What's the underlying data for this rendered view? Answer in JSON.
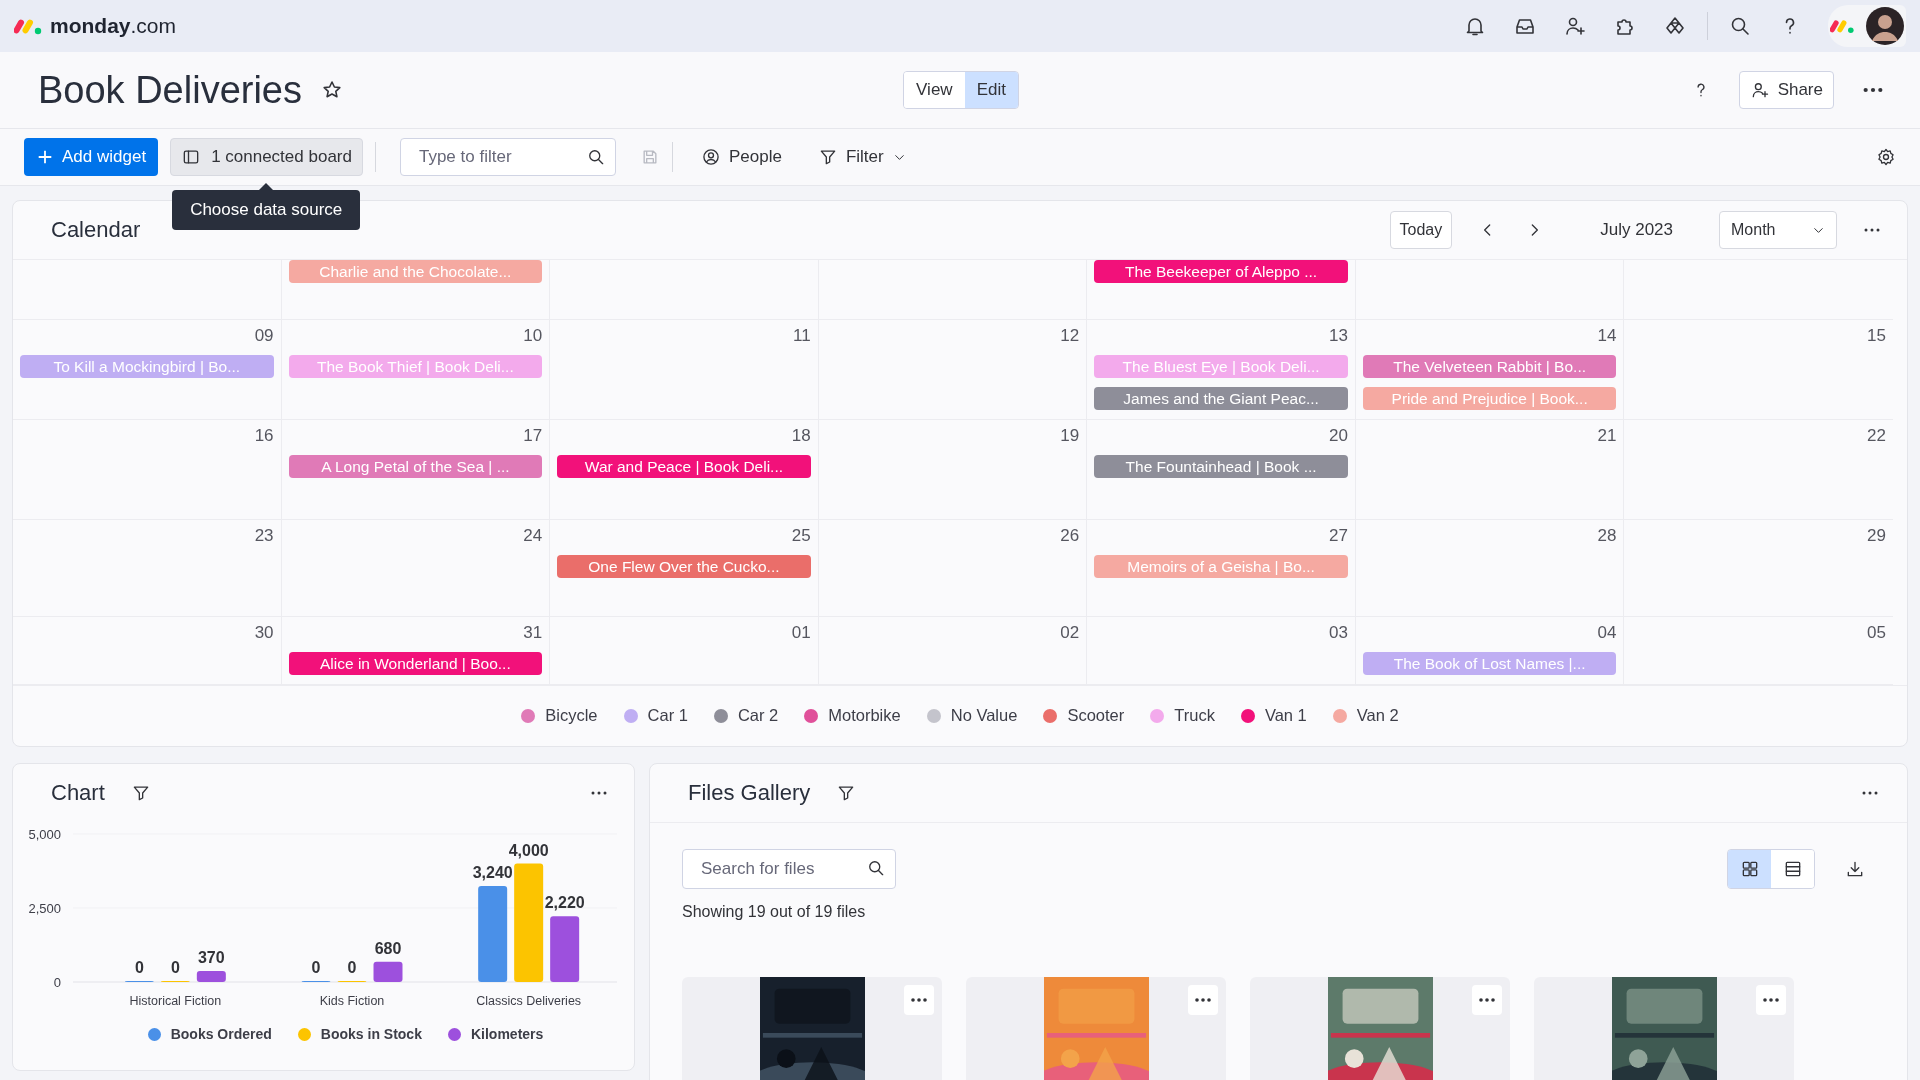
{
  "topbar": {
    "logo_word": "monday",
    "logo_suffix": ".com"
  },
  "header": {
    "title": "Book Deliveries",
    "modes": [
      {
        "label": "View",
        "selected": false
      },
      {
        "label": "Edit",
        "selected": true
      }
    ],
    "share": "Share"
  },
  "toolbar": {
    "add_widget": "Add widget",
    "connected_board": "1 connected board",
    "tooltip": "Choose data source",
    "filter_field": {
      "placeholder": "Type to filter"
    },
    "people": "People",
    "filter": "Filter"
  },
  "calendar": {
    "title": "Calendar",
    "today": "Today",
    "month_label": "July 2023",
    "view": "Month",
    "weeks": [
      [
        {
          "kind": "scrolled"
        },
        {
          "kind": "scrolled",
          "events": [
            {
              "title": "Charlie and the Chocolate...",
              "color": "#f5a9a1"
            }
          ]
        },
        {
          "kind": "scrolled"
        },
        {
          "kind": "scrolled"
        },
        {
          "kind": "scrolled",
          "events": [
            {
              "title": "The Beekeeper of Aleppo ...",
              "color": "#f2117a"
            }
          ]
        },
        {
          "kind": "scrolled"
        },
        {
          "kind": "scrolled"
        }
      ],
      [
        {
          "kind": "date",
          "day": "09",
          "events": [
            {
              "title": "To Kill a Mockingbird | Bo...",
              "color": "#bfaef3"
            }
          ]
        },
        {
          "kind": "date",
          "day": "10",
          "events": [
            {
              "title": "The Book Thief | Book Deli...",
              "color": "#f3aaec"
            }
          ]
        },
        {
          "kind": "date",
          "day": "11"
        },
        {
          "kind": "date",
          "day": "12"
        },
        {
          "kind": "date",
          "day": "13",
          "events": [
            {
              "title": "The Bluest Eye | Book Deli...",
              "color": "#f3aaec"
            },
            {
              "title": "James and the Giant Peac...",
              "color": "#8e8e99"
            }
          ]
        },
        {
          "kind": "date",
          "day": "14",
          "events": [
            {
              "title": "The Velveteen Rabbit | Bo...",
              "color": "#e07ab7"
            },
            {
              "title": "Pride and Prejudice | Book...",
              "color": "#f5a9a1"
            }
          ]
        },
        {
          "kind": "date",
          "day": "15"
        }
      ],
      [
        {
          "kind": "date",
          "day": "16"
        },
        {
          "kind": "date",
          "day": "17",
          "events": [
            {
              "title": "A Long Petal of the Sea | ...",
              "color": "#e07ab7"
            }
          ]
        },
        {
          "kind": "date",
          "day": "18",
          "events": [
            {
              "title": "War and Peace | Book Deli...",
              "color": "#f2117a"
            }
          ]
        },
        {
          "kind": "date",
          "day": "19"
        },
        {
          "kind": "date",
          "day": "20",
          "events": [
            {
              "title": "The Fountainhead | Book ...",
              "color": "#8e8e99"
            }
          ]
        },
        {
          "kind": "date",
          "day": "21"
        },
        {
          "kind": "date",
          "day": "22"
        }
      ],
      [
        {
          "kind": "date",
          "day": "23"
        },
        {
          "kind": "date",
          "day": "24"
        },
        {
          "kind": "date",
          "day": "25",
          "events": [
            {
              "title": "One Flew Over the Cucko...",
              "color": "#ea6e6a"
            }
          ]
        },
        {
          "kind": "date",
          "day": "26"
        },
        {
          "kind": "date",
          "day": "27",
          "events": [
            {
              "title": "Memoirs of a Geisha | Bo...",
              "color": "#f5a9a1"
            }
          ]
        },
        {
          "kind": "date",
          "day": "28"
        },
        {
          "kind": "date",
          "day": "29"
        }
      ],
      [
        {
          "kind": "date",
          "day": "30"
        },
        {
          "kind": "date",
          "day": "31",
          "events": [
            {
              "title": "Alice in Wonderland | Boo...",
              "color": "#f2117a"
            }
          ]
        },
        {
          "kind": "date",
          "day": "01"
        },
        {
          "kind": "date",
          "day": "02"
        },
        {
          "kind": "date",
          "day": "03"
        },
        {
          "kind": "date",
          "day": "04",
          "events": [
            {
              "title": "The Book of Lost Names |...",
              "color": "#bfaef3"
            }
          ]
        },
        {
          "kind": "date",
          "day": "05"
        }
      ]
    ],
    "legend": [
      {
        "label": "Bicycle",
        "color": "#e07ab7"
      },
      {
        "label": "Car 1",
        "color": "#bfaef3"
      },
      {
        "label": "Car 2",
        "color": "#8e8e99"
      },
      {
        "label": "Motorbike",
        "color": "#e0509a"
      },
      {
        "label": "No Value",
        "color": "#c4c4cc"
      },
      {
        "label": "Scooter",
        "color": "#ea6e6a"
      },
      {
        "label": "Truck",
        "color": "#f3aaec"
      },
      {
        "label": "Van 1",
        "color": "#f2117a"
      },
      {
        "label": "Van 2",
        "color": "#f5a9a1"
      }
    ]
  },
  "chart_widget": {
    "title": "Chart",
    "chart_data": {
      "type": "bar",
      "categories": [
        "Historical Fiction",
        "Kids Fiction",
        "Classics Deliveries"
      ],
      "series": [
        {
          "name": "Books Ordered",
          "color": "#4a90e8",
          "values": [
            0,
            0,
            3240
          ],
          "value_labels": [
            "0",
            "0",
            "3,240"
          ]
        },
        {
          "name": "Books in Stock",
          "color": "#fcc400",
          "values": [
            0,
            0,
            4000
          ],
          "value_labels": [
            "0",
            "0",
            "4,000"
          ]
        },
        {
          "name": "Kilometers",
          "color": "#9d50dd",
          "values": [
            370,
            680,
            2220
          ],
          "value_labels": [
            "370",
            "680",
            "2,220"
          ]
        }
      ],
      "ylim": [
        0,
        5000
      ],
      "yticks": [
        {
          "value": 0,
          "label": "0"
        },
        {
          "value": 2500,
          "label": "2,500"
        },
        {
          "value": 5000,
          "label": "5,000"
        }
      ],
      "legend": "bottom",
      "data_labels": true
    }
  },
  "gallery": {
    "title": "Files Gallery",
    "search": {
      "placeholder": "Search for files"
    },
    "count": "Showing 19 out of 19 files",
    "views": [
      {
        "kind": "grid",
        "selected": true
      },
      {
        "kind": "list",
        "selected": false
      }
    ]
  }
}
